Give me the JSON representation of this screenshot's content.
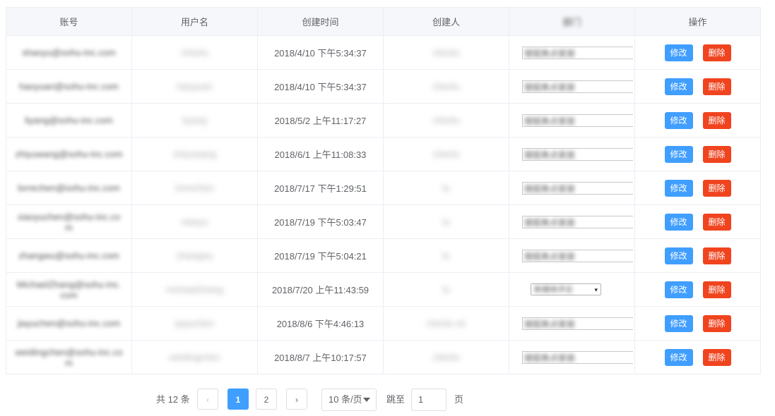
{
  "table": {
    "headers": {
      "account": "账号",
      "username": "用户名",
      "created_at": "创建时间",
      "creator": "创建人",
      "department": "部门",
      "actions": "操作"
    },
    "edit_label": "修改",
    "delete_label": "删除",
    "rows": [
      {
        "account": "shaoyu@sohu-inc.com",
        "username": "chenlu",
        "created_at": "2018/4/10 下午5:34:37",
        "creator": "chenlu",
        "department": "搜狐焦点家居"
      },
      {
        "account": "haoyuan@sohu-inc.com",
        "username": "haoyuan",
        "created_at": "2018/4/10 下午5:34:37",
        "creator": "chenlu",
        "department": "搜狐焦点家居"
      },
      {
        "account": "liyang@sohu-inc.com",
        "username": "liyang",
        "created_at": "2018/5/2 上午11:17:27",
        "creator": "chenlu",
        "department": "搜狐焦点家居"
      },
      {
        "account": "zhiyuwang@sohu-inc.com",
        "username": "zhiyuwang",
        "created_at": "2018/6/1 上午11:08:33",
        "creator": "chenlu",
        "department": "搜狐焦点家居"
      },
      {
        "account": "lorrechen@sohu-inc.com",
        "username": "lorrechen",
        "created_at": "2018/7/17 下午1:29:51",
        "creator": "lu",
        "department": "搜狐焦点家居"
      },
      {
        "account": "xiaoyuchen@sohu-inc.com",
        "username": "xiaoyu",
        "created_at": "2018/7/19 下午5:03:47",
        "creator": "lu",
        "department": "搜狐焦点家居"
      },
      {
        "account": "zhangwu@sohu-inc.com",
        "username": "zhangwu",
        "created_at": "2018/7/19 下午5:04:21",
        "creator": "lu",
        "department": "搜狐焦点家居"
      },
      {
        "account": "MichaelZhang@sohu-inc.com",
        "username": "michaelzhang",
        "created_at": "2018/7/20 上午11:43:59",
        "creator": "lu",
        "department": "新媒体评论"
      },
      {
        "account": "jiayuchen@sohu-inc.com",
        "username": "jiayuchen",
        "created_at": "2018/8/6 下午4:46:13",
        "creator": "chenlu sh",
        "department": "搜狐焦点家居"
      },
      {
        "account": "weidingchen@sohu-inc.com",
        "username": "weidingchen",
        "created_at": "2018/8/7 上午10:17:57",
        "creator": "chenlu",
        "department": "搜狐焦点家居"
      }
    ]
  },
  "pagination": {
    "total_label": "共 12 条",
    "prev_icon": "chevron-left-icon",
    "next_icon": "chevron-right-icon",
    "pages": [
      "1",
      "2"
    ],
    "current_page": "1",
    "page_size_label": "10 条/页",
    "jump_label": "跳至",
    "jump_value": "1",
    "page_unit": "页"
  },
  "colors": {
    "primary": "#409eff",
    "danger": "#f0441f",
    "header_bg": "#f5f7fa",
    "border": "#ebeef5"
  }
}
